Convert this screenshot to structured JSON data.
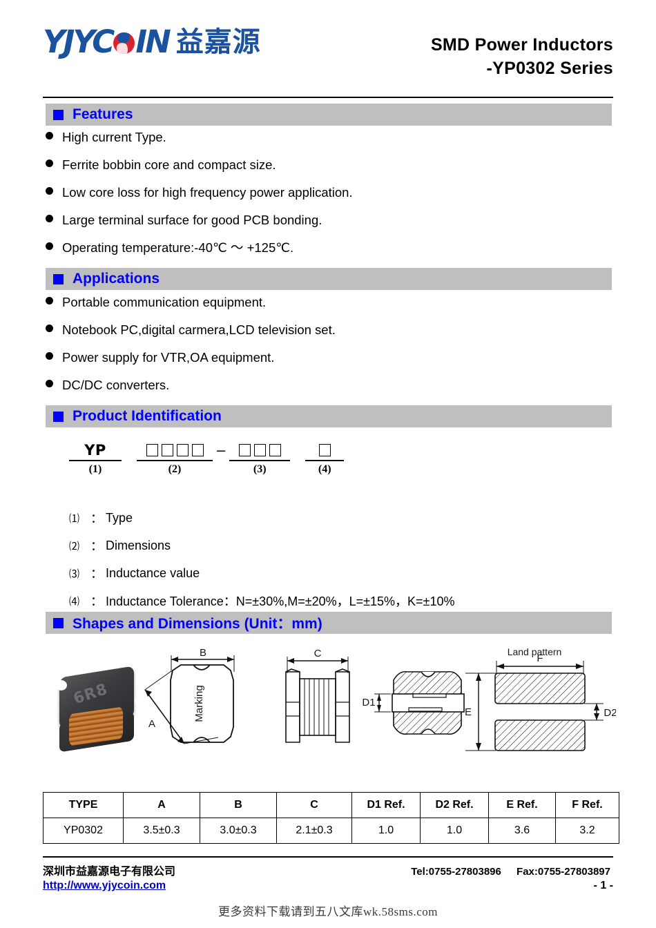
{
  "header": {
    "logo_latin": "YJYC",
    "logo_latin_tail": "IN",
    "logo_cn": "益嘉源",
    "title_line1": "SMD Power Inductors",
    "title_line2": "-YP0302 Series"
  },
  "sections": {
    "features": {
      "title": "Features",
      "items": [
        "High current Type.",
        "Ferrite bobbin core and compact size.",
        "Low core loss for high frequency power application.",
        "Large terminal surface for good PCB bonding.",
        "Operating temperature:-40℃ ～ +125℃."
      ]
    },
    "applications": {
      "title": "Applications",
      "items": [
        "Portable communication equipment.",
        "Notebook PC,digital carmera,LCD television set.",
        "Power supply for VTR,OA equipment.",
        "DC/DC converters."
      ]
    },
    "product_identification": {
      "title": "Product Identification",
      "diagram": {
        "prefix": "YP",
        "group1_label": "(1)",
        "group2_boxes": 4,
        "group2_label": "(2)",
        "separator": "–",
        "group3_boxes": 3,
        "group3_label": "(3)",
        "group4_boxes": 1,
        "group4_label": "(4)"
      },
      "legend": [
        {
          "key": "⑴",
          "colon": "：",
          "value": "Type"
        },
        {
          "key": "⑵",
          "colon": "：",
          "value": "Dimensions"
        },
        {
          "key": "⑶",
          "colon": "：",
          "value": "Inductance value"
        },
        {
          "key": "⑷",
          "colon": "：",
          "value": "Inductance Tolerance：N=±30%,M=±20%，L=±15%，K=±10%"
        }
      ]
    },
    "shapes_dimensions": {
      "title": "Shapes and Dimensions (Unit：mm)",
      "drawing_labels": {
        "photo_marking": "6R8",
        "marking_text": "Marking",
        "dim_a": "A",
        "dim_b": "B",
        "dim_c": "C",
        "dim_d1": "D1",
        "dim_d2": "D2",
        "dim_e": "E",
        "dim_f": "F",
        "land_pattern": "Land pattern"
      }
    }
  },
  "table": {
    "headers": [
      "TYPE",
      "A",
      "B",
      "C",
      "D1 Ref.",
      "D2 Ref.",
      "E Ref.",
      "F Ref."
    ],
    "rows": [
      [
        "YP0302",
        "3.5±0.3",
        "3.0±0.3",
        "2.1±0.3",
        "1.0",
        "1.0",
        "3.6",
        "3.2"
      ]
    ]
  },
  "footer": {
    "company": "深圳市益嘉源电子有限公司",
    "tel": "Tel:0755-27803896",
    "fax": "Fax:0755-27803897",
    "url": "http://www.yjycoin.com",
    "page": "- 1 -",
    "watermark": "更多资料下载请到五八文库wk.58sms.com"
  },
  "colors": {
    "section_bar_bg": "#BFBFBF",
    "section_title": "#0000FF",
    "logo_blue": "#1A52A0",
    "logo_red": "#D9232E",
    "link_blue": "#0000CC"
  }
}
